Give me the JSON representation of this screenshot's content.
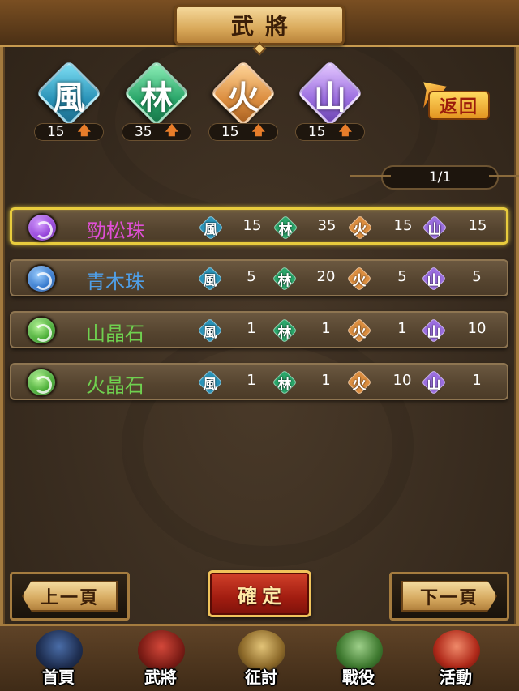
{
  "header": {
    "title": "武將"
  },
  "attributes": [
    {
      "char": "風",
      "value": "15",
      "color": "#3aa5c9"
    },
    {
      "char": "林",
      "value": "35",
      "color": "#2fb27a"
    },
    {
      "char": "火",
      "value": "15",
      "color": "#d98a3c"
    },
    {
      "char": "山",
      "value": "15",
      "color": "#9b72d6"
    }
  ],
  "return_label": "返回",
  "page_indicator": "1/1",
  "rows": [
    {
      "name": "勁松珠",
      "name_color": "#e04fd6",
      "orb_color": "#8f3ad6",
      "values": [
        "15",
        "35",
        "15",
        "15"
      ]
    },
    {
      "name": "青木珠",
      "name_color": "#4f9fe8",
      "orb_color": "#2d72c9",
      "values": [
        "5",
        "20",
        "5",
        "5"
      ]
    },
    {
      "name": "山晶石",
      "name_color": "#6fd04f",
      "orb_color": "#3fa62c",
      "values": [
        "1",
        "1",
        "1",
        "10"
      ]
    },
    {
      "name": "火晶石",
      "name_color": "#6fd04f",
      "orb_color": "#3fa62c",
      "values": [
        "1",
        "1",
        "10",
        "1"
      ]
    }
  ],
  "mini_chars": [
    "風",
    "林",
    "火",
    "山"
  ],
  "buttons": {
    "prev": "上一頁",
    "confirm": "確定",
    "next": "下一頁"
  },
  "tabs": [
    {
      "label": "首頁",
      "icon": "home-icon"
    },
    {
      "label": "武將",
      "icon": "general-icon"
    },
    {
      "label": "征討",
      "icon": "expedition-icon"
    },
    {
      "label": "戰役",
      "icon": "campaign-icon"
    },
    {
      "label": "活動",
      "icon": "event-icon"
    }
  ]
}
